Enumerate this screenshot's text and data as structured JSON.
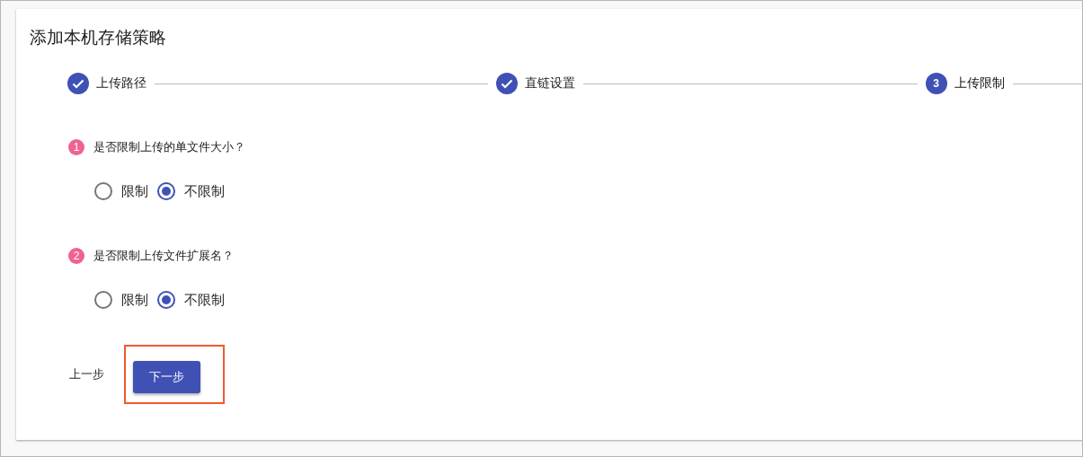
{
  "title": "添加本机存储策略",
  "steps": [
    {
      "label": "上传路径",
      "kind": "done",
      "selected": false
    },
    {
      "label": "直链设置",
      "kind": "done",
      "selected": false
    },
    {
      "label": "上传限制",
      "kind": "number",
      "number": "3",
      "selected": true
    }
  ],
  "questions": [
    {
      "number": "1",
      "text": "是否限制上传的单文件大小？",
      "options": [
        {
          "label": "限制",
          "selected": false
        },
        {
          "label": "不限制",
          "selected": true
        }
      ]
    },
    {
      "number": "2",
      "text": "是否限制上传文件扩展名？",
      "options": [
        {
          "label": "限制",
          "selected": false
        },
        {
          "label": "不限制",
          "selected": true
        }
      ]
    }
  ],
  "back_button": {
    "label": "上一步"
  },
  "next_button": {
    "label": "下一步",
    "highlighted": true
  }
}
